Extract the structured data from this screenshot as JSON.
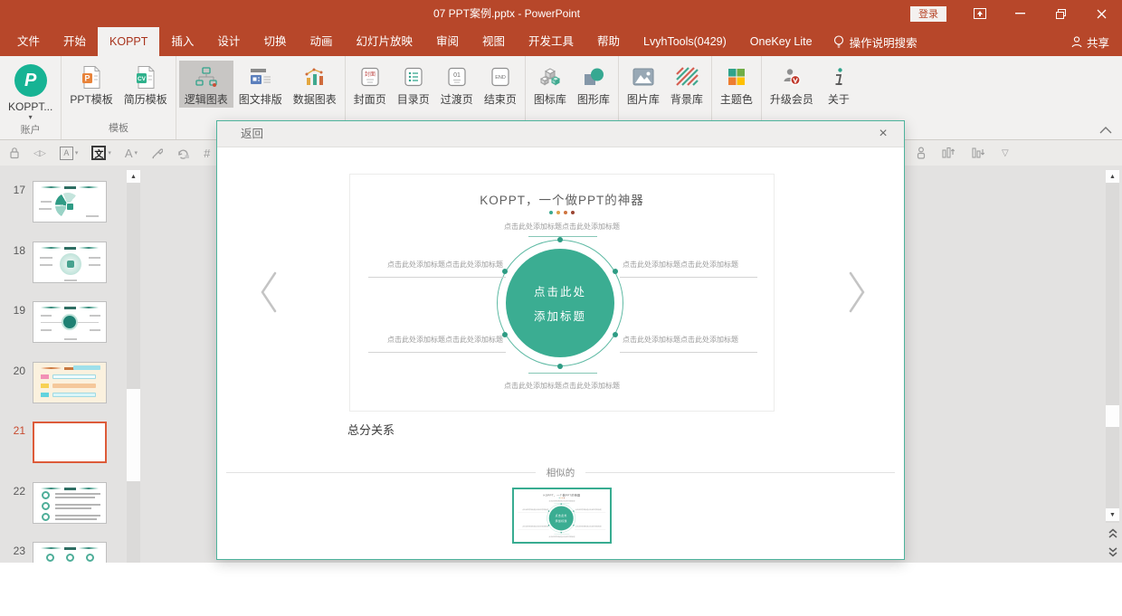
{
  "colors": {
    "titlebar": "#B7472A",
    "accent": "#3BAD92",
    "selection": "#DD5B39"
  },
  "titlebar": {
    "title": "07 PPT案例.pptx - PowerPoint",
    "login_label": "登录"
  },
  "menubar": {
    "tabs": [
      "文件",
      "开始",
      "KOPPT",
      "插入",
      "设计",
      "切换",
      "动画",
      "幻灯片放映",
      "审阅",
      "视图",
      "开发工具",
      "帮助",
      "LvyhTools(0429)",
      "OneKey Lite"
    ],
    "active_tab": "KOPPT",
    "search_label": "操作说明搜索",
    "share_label": "共享"
  },
  "ribbon": {
    "account_group_label": "账户",
    "template_group_label": "模板",
    "buttons": {
      "koppt": "KOPPT...",
      "ppt_template": "PPT模板",
      "resume_template": "简历模板",
      "logic_chart": "逻辑图表",
      "pic_text": "图文排版",
      "data_chart": "数据图表",
      "cover_page": "封面页",
      "toc_page": "目录页",
      "transition_page": "过渡页",
      "end_page": "结束页",
      "icon_lib": "图标库",
      "shape_lib": "图形库",
      "image_lib": "图片库",
      "background_lib": "背景库",
      "theme_color": "主题色",
      "upgrade": "升级会员",
      "about": "关于"
    },
    "glyphs": {
      "koppt_p": "P",
      "ppt_p": "P",
      "cv": "CV",
      "cover": "封面",
      "transition": "01",
      "end": "END"
    }
  },
  "slide_panel": {
    "slide_numbers": [
      "17",
      "18",
      "19",
      "20",
      "21",
      "22",
      "23"
    ],
    "selected_number": "21"
  },
  "dialog": {
    "back_label": "返回",
    "close_label": "×",
    "preview": {
      "title": "KOPPT，一个做PPT的神器",
      "placeholder_text": "点击此处添加标题点击此处添加标题",
      "center_line1": "点击此处",
      "center_line2": "添加标题",
      "dot_colors": [
        "#3AA98F",
        "#DFA14C",
        "#CF7440",
        "#9C4633"
      ]
    },
    "caption": "总分关系",
    "similar_label": "相似的"
  }
}
